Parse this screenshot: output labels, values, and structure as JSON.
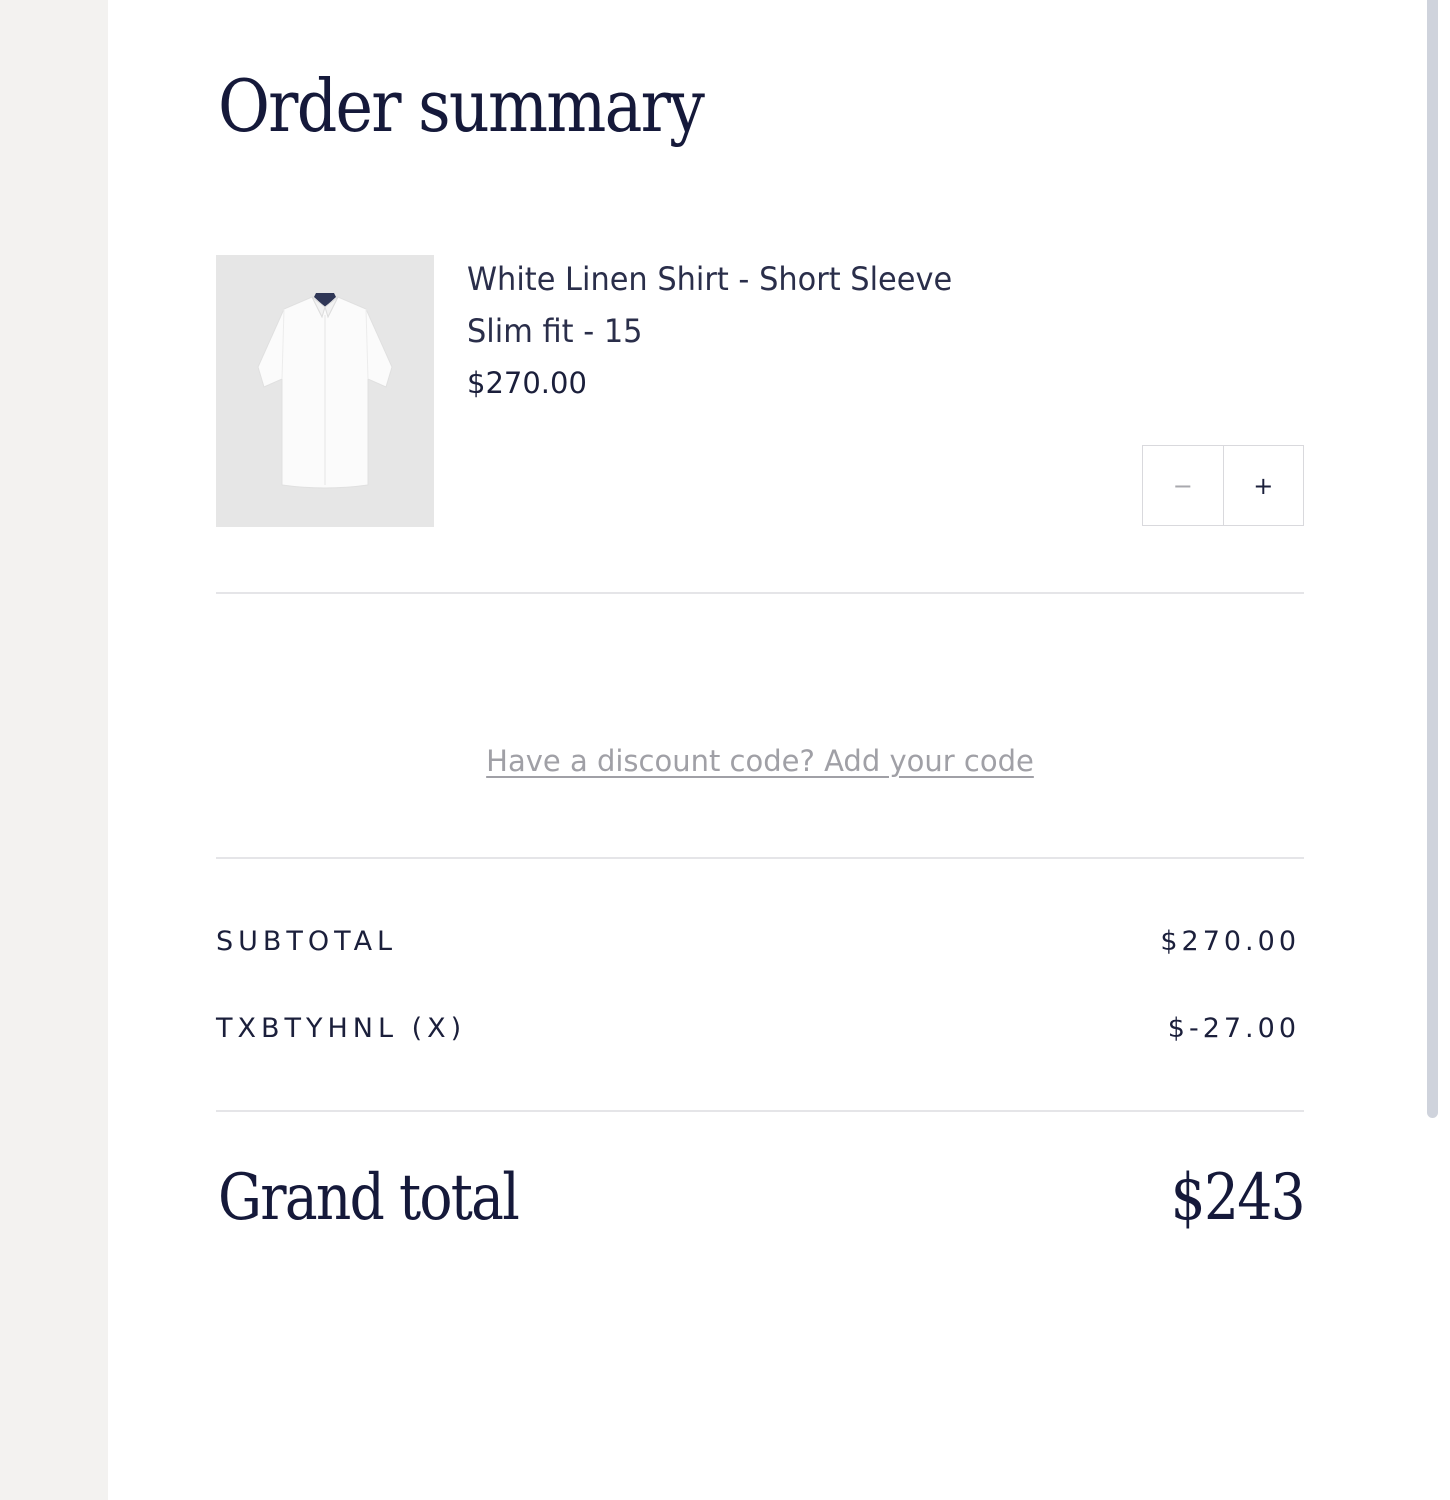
{
  "summary": {
    "title": "Order summary"
  },
  "item": {
    "name": "White Linen Shirt - Short Sleeve",
    "variant": "Slim fit - 15",
    "price": "$270.00",
    "image_icon": "shirt-image",
    "quantity_controls": {
      "decrement_label": "−",
      "increment_label": "+"
    }
  },
  "discount": {
    "link_text": "Have a discount code? Add your code"
  },
  "totals": {
    "subtotal_label": "SUBTOTAL",
    "subtotal_value": "$270.00",
    "discount_label": "TXBTYHNL (X)",
    "discount_value": "$-27.00",
    "grand_total_label": "Grand total",
    "grand_total_value": "$243"
  },
  "colors": {
    "text_primary": "#15193a",
    "muted": "#a0a0a6",
    "page_background": "#f3f2f0",
    "panel_background": "#ffffff",
    "thumbnail_background": "#e6e6e6"
  }
}
